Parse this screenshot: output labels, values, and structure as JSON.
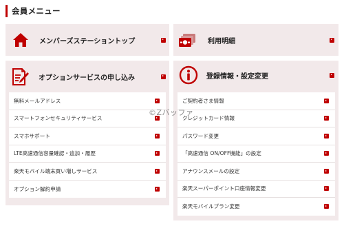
{
  "header": {
    "title": "会員メニュー"
  },
  "cards": {
    "member_station": {
      "title": "メンバーズステーショントップ",
      "icon": "house-icon"
    },
    "usage": {
      "title": "利用明細",
      "icon": "bill-icon"
    },
    "options": {
      "title": "オプションサービスの申し込み",
      "icon": "form-pen-icon",
      "items": [
        "無料メールアドレス",
        "スマートフォンセキュリティサービス",
        "スマホサポート",
        "LTE高速通信容量確認・追加・履歴",
        "楽天モバイル端末買い増しサービス",
        "オプション解約申請"
      ]
    },
    "registration": {
      "title": "登録情報・設定変更",
      "icon": "info-icon",
      "items": [
        "ご契約者さま情報",
        "クレジットカード情報",
        "パスワード変更",
        "「高速通信 ON/OFF機能」の設定",
        "アナウンスメールの設定",
        "楽天スーパーポイント口座情報変更",
        "楽天モバイルプラン変更"
      ]
    }
  },
  "watermark": "©Zバッファ",
  "colors": {
    "accent": "#bf0000",
    "panel_bg": "#f2e9ea"
  }
}
